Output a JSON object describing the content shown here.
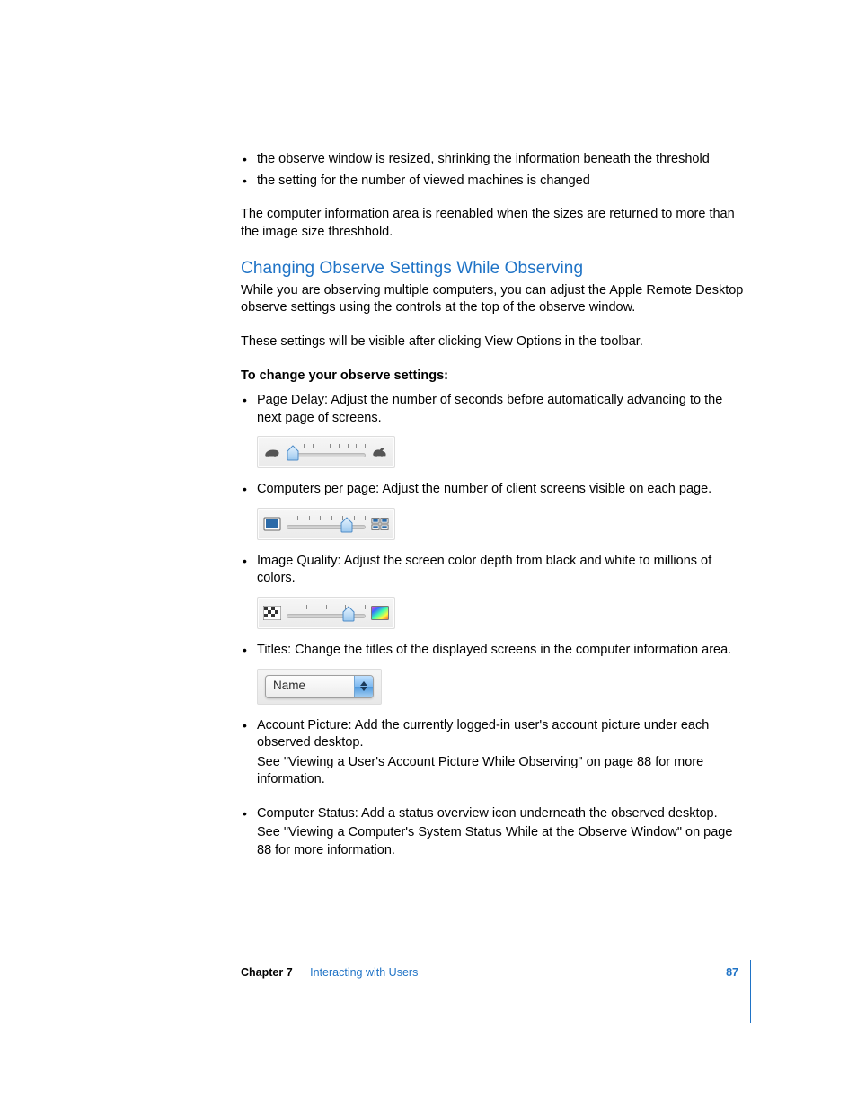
{
  "intro_bullets": [
    "the observe window is resized, shrinking the information beneath the threshold",
    "the setting for the number of viewed machines is changed"
  ],
  "intro_para": "The computer information area is reenabled when the sizes are returned to more than the image size threshhold.",
  "section_heading": "Changing Observe Settings While Observing",
  "section_para1": "While you are observing multiple computers, you can adjust the Apple Remote Desktop observe settings using the controls at the top of the observe window.",
  "section_para2": "These settings will be visible after clicking View Options in the toolbar.",
  "instructions_label": "To change your observe settings:",
  "items": [
    {
      "text": "Page Delay:  Adjust the number of seconds before automatically advancing to the next page of screens."
    },
    {
      "text": "Computers per page:  Adjust the number of client screens visible on each page."
    },
    {
      "text": "Image Quality:  Adjust the screen color depth from black and white to millions of colors."
    },
    {
      "text": "Titles:  Change the titles of the displayed screens in the computer information area."
    },
    {
      "text": "Account Picture:  Add the currently logged-in user's account picture under each observed desktop.",
      "subline": "See \"Viewing a User's Account Picture While Observing\" on page 88 for more information."
    },
    {
      "text": "Computer Status:  Add a status overview icon underneath the observed desktop.",
      "subline": "See \"Viewing a Computer's System Status While at the Observe Window\" on page 88 for more information."
    }
  ],
  "dropdown_value": "Name",
  "slider1": {
    "tick_count": 10,
    "thumb_pos_pct": 8
  },
  "slider2": {
    "tick_count": 8,
    "thumb_pos_pct": 76
  },
  "slider3": {
    "tick_count": 5,
    "thumb_pos_pct": 78
  },
  "footer": {
    "chapter_label": "Chapter 7",
    "chapter_title": "Interacting with Users",
    "page_number": "87"
  }
}
